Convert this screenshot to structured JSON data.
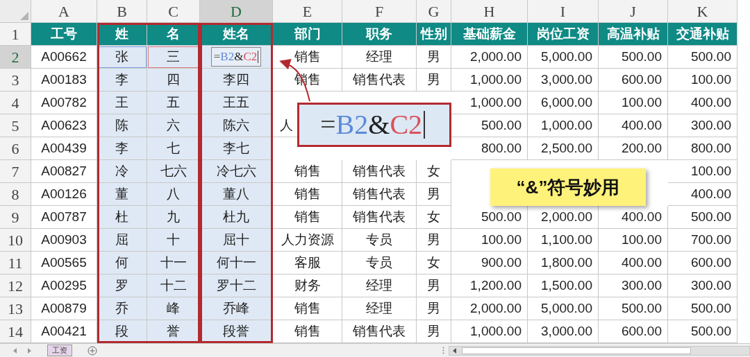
{
  "columns": [
    {
      "letter": "A",
      "header": "工号",
      "selected": false,
      "shaded": false
    },
    {
      "letter": "B",
      "header": "姓",
      "selected": false,
      "shaded": true
    },
    {
      "letter": "C",
      "header": "名",
      "selected": false,
      "shaded": true
    },
    {
      "letter": "D",
      "header": "姓名",
      "selected": true,
      "shaded": true
    },
    {
      "letter": "E",
      "header": "部门",
      "selected": false,
      "shaded": false
    },
    {
      "letter": "F",
      "header": "职务",
      "selected": false,
      "shaded": false
    },
    {
      "letter": "G",
      "header": "性别",
      "selected": false,
      "shaded": false
    },
    {
      "letter": "H",
      "header": "基础薪金",
      "selected": false,
      "shaded": false
    },
    {
      "letter": "I",
      "header": "岗位工资",
      "selected": false,
      "shaded": false
    },
    {
      "letter": "J",
      "header": "高温补贴",
      "selected": false,
      "shaded": false
    },
    {
      "letter": "K",
      "header": "交通补贴",
      "selected": false,
      "shaded": false
    }
  ],
  "header_row_number": "1",
  "rows": [
    {
      "number": "2",
      "selected": true,
      "cells": [
        "A00662",
        "张",
        "三",
        null,
        "销售",
        "经理",
        "男",
        "2,000.00",
        "5,000.00",
        "500.00",
        "500.00"
      ]
    },
    {
      "number": "3",
      "selected": false,
      "cells": [
        "A00183",
        "李",
        "四",
        "李四",
        "销售",
        "销售代表",
        "男",
        "1,000.00",
        "3,000.00",
        "600.00",
        "100.00"
      ]
    },
    {
      "number": "4",
      "selected": false,
      "cells": [
        "A00782",
        "王",
        "五",
        "王五",
        null,
        null,
        null,
        "1,000.00",
        "6,000.00",
        "100.00",
        "400.00"
      ]
    },
    {
      "number": "5",
      "selected": false,
      "cells": [
        "A00623",
        "陈",
        "六",
        "陈六",
        {
          "text": "人",
          "clipped": true
        },
        null,
        null,
        "500.00",
        "1,000.00",
        "400.00",
        "300.00"
      ]
    },
    {
      "number": "6",
      "selected": false,
      "cells": [
        "A00439",
        "李",
        "七",
        "李七",
        null,
        null,
        null,
        "800.00",
        "2,500.00",
        "200.00",
        "800.00"
      ]
    },
    {
      "number": "7",
      "selected": false,
      "cells": [
        "A00827",
        "冷",
        "七六",
        "冷七六",
        "销售",
        "销售代表",
        "女",
        null,
        null,
        null,
        "100.00"
      ]
    },
    {
      "number": "8",
      "selected": false,
      "cells": [
        "A00126",
        "董",
        "八",
        "董八",
        "销售",
        "销售代表",
        "男",
        null,
        null,
        null,
        "400.00"
      ]
    },
    {
      "number": "9",
      "selected": false,
      "cells": [
        "A00787",
        "杜",
        "九",
        "杜九",
        "销售",
        "销售代表",
        "女",
        "500.00",
        "2,000.00",
        "400.00",
        "500.00"
      ]
    },
    {
      "number": "10",
      "selected": false,
      "cells": [
        "A00903",
        "屈",
        "十",
        "屈十",
        "人力资源",
        "专员",
        "男",
        "100.00",
        "1,100.00",
        "100.00",
        "700.00"
      ]
    },
    {
      "number": "11",
      "selected": false,
      "cells": [
        "A00565",
        "何",
        "十一",
        "何十一",
        "客服",
        "专员",
        "女",
        "900.00",
        "1,800.00",
        "400.00",
        "600.00"
      ]
    },
    {
      "number": "12",
      "selected": false,
      "cells": [
        "A00295",
        "罗",
        "十二",
        "罗十二",
        "财务",
        "经理",
        "男",
        "1,200.00",
        "1,500.00",
        "300.00",
        "300.00"
      ]
    },
    {
      "number": "13",
      "selected": false,
      "cells": [
        "A00879",
        "乔",
        "峰",
        "乔峰",
        "销售",
        "经理",
        "男",
        "2,000.00",
        "5,000.00",
        "500.00",
        "500.00"
      ]
    },
    {
      "number": "14",
      "selected": false,
      "cells": [
        "A00421",
        "段",
        "誉",
        "段誉",
        "销售",
        "销售代表",
        "男",
        "1,000.00",
        "3,000.00",
        "600.00",
        "500.00"
      ]
    }
  ],
  "formula_cell": {
    "parts": [
      {
        "text": "=",
        "color": "#555555"
      },
      {
        "text": "B2",
        "color": "#5b8ad8"
      },
      {
        "text": "&",
        "color": "#222222"
      },
      {
        "text": "C2",
        "color": "#d9505a"
      }
    ]
  },
  "callout": {
    "parts": [
      {
        "text": "=",
        "color": "#444444"
      },
      {
        "text": "B2",
        "color": "#5b8ad8"
      },
      {
        "text": "&",
        "color": "#222222"
      },
      {
        "text": "C2",
        "color": "#d9505a"
      }
    ]
  },
  "badge": "“&”符号妙用",
  "sheet_tabs": [
    {
      "label": "工资",
      "selected": true
    }
  ]
}
